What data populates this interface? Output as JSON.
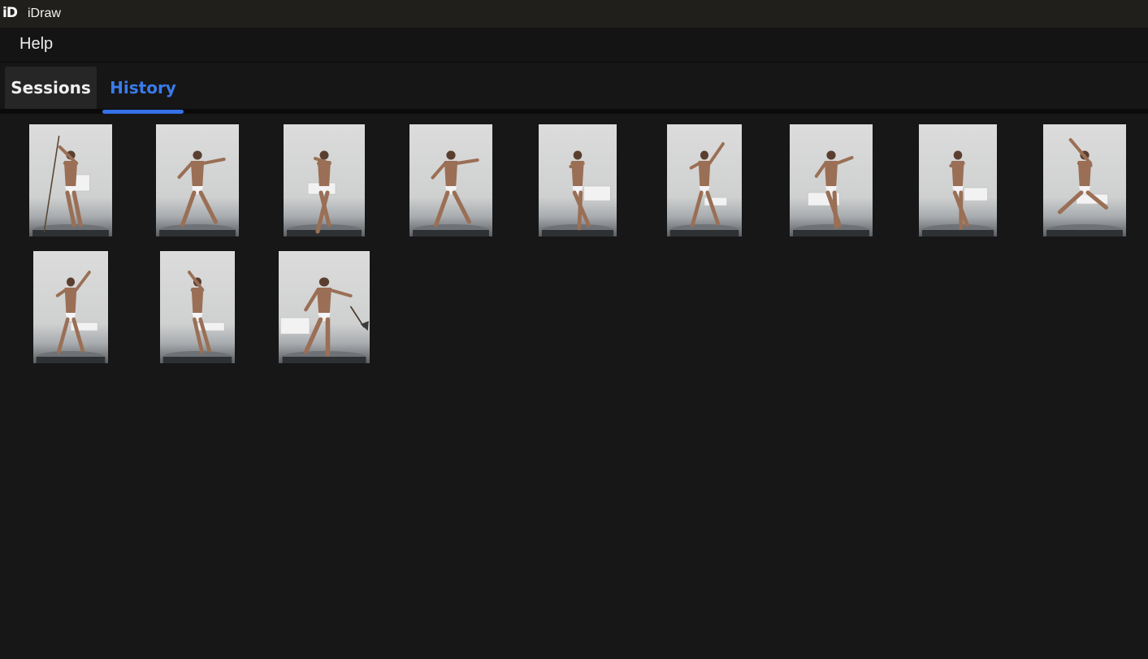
{
  "app": {
    "icon_text": "iD",
    "title": "iDraw"
  },
  "menu": {
    "help_label": "Help"
  },
  "tabs": {
    "sessions_label": "Sessions",
    "history_label": "History",
    "active": "History"
  },
  "colors": {
    "accent": "#3571e6",
    "background": "#171717"
  },
  "history": {
    "thumbnails": [
      {
        "pose": "standing with staff, seated on box"
      },
      {
        "pose": "crouching lunge"
      },
      {
        "pose": "back view, leg raised"
      },
      {
        "pose": "crouching lunge, side"
      },
      {
        "pose": "leg raised on box"
      },
      {
        "pose": "arm raised, box"
      },
      {
        "pose": "flexing, stepping on box"
      },
      {
        "pose": "stepping on box"
      },
      {
        "pose": "kneeling, arm extended"
      },
      {
        "pose": "arm raised, box at feet"
      },
      {
        "pose": "arm raised, stepping on box"
      },
      {
        "pose": "holding axe, stepping on box"
      }
    ]
  }
}
